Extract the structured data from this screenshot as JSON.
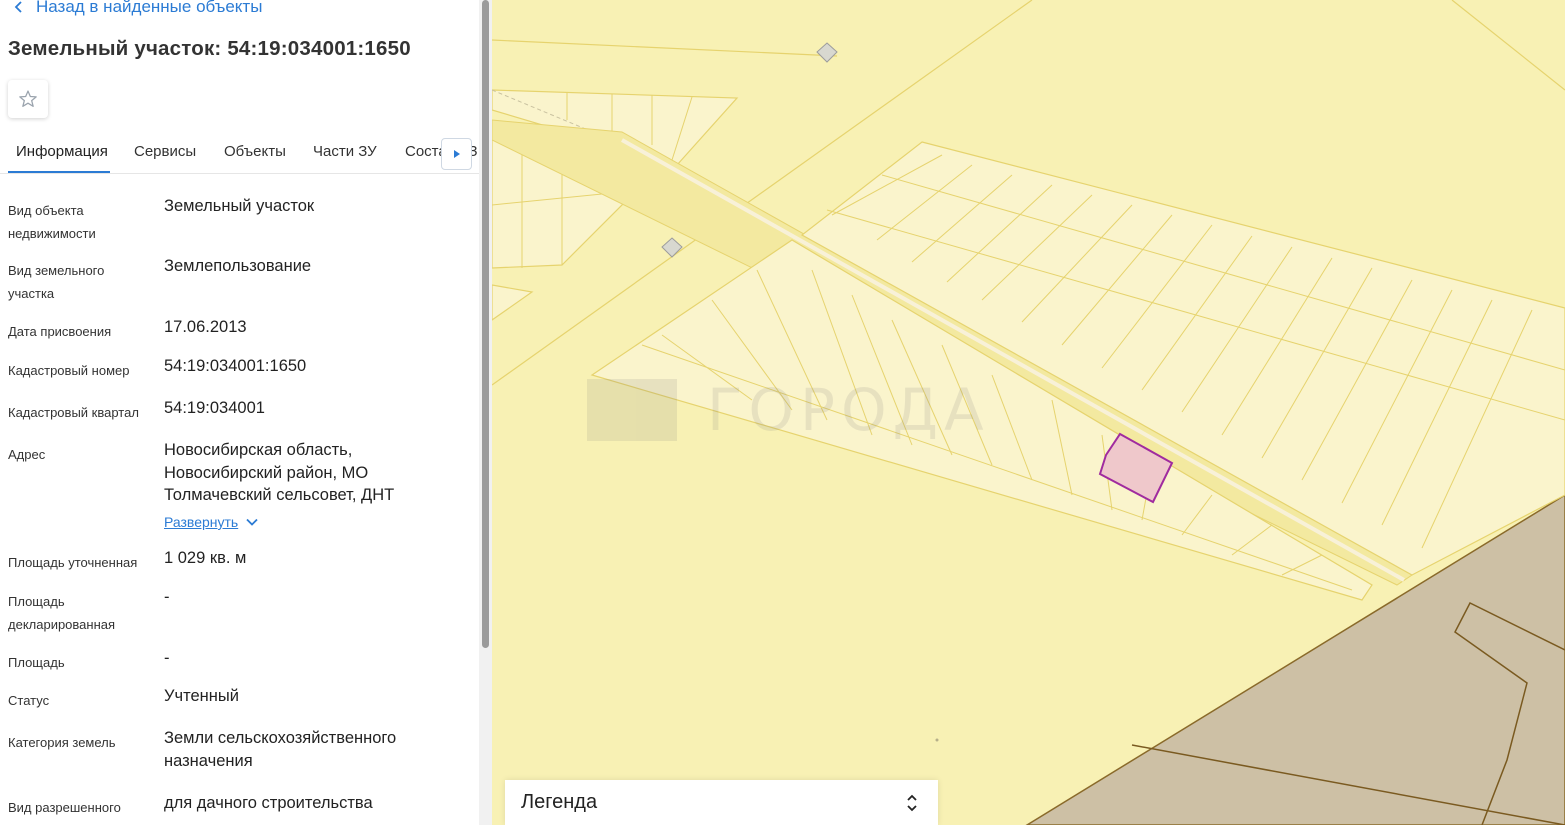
{
  "back_link": {
    "label": "Назад в найденные объекты"
  },
  "title": "Земельный участок: 54:19:034001:1650",
  "tabs": [
    {
      "label": "Информация",
      "active": true
    },
    {
      "label": "Сервисы"
    },
    {
      "label": "Объекты"
    },
    {
      "label": "Части ЗУ"
    },
    {
      "label": "Состав ЕЗП"
    }
  ],
  "info": [
    {
      "label": "Вид объекта недвижимости",
      "value": "Земельный участок"
    },
    {
      "label": "Вид земельного участка",
      "value": "Землепользование"
    },
    {
      "label": "Дата присвоения",
      "value": "17.06.2013"
    },
    {
      "label": "Кадастровый номер",
      "value": "54:19:034001:1650"
    },
    {
      "label": "Кадастровый квартал",
      "value": "54:19:034001"
    },
    {
      "label": "Адрес",
      "value": "Новосибирская область, Новосибирский район, МО Толмачевский сельсовет, ДНТ",
      "expand_label": "Развернуть"
    },
    {
      "label": "Площадь уточненная",
      "value": "1 029 кв. м"
    },
    {
      "label": "Площадь декларированная",
      "value": "-"
    },
    {
      "label": "Площадь",
      "value": "-"
    },
    {
      "label": "Статус",
      "value": "Учтенный"
    },
    {
      "label": "Категория земель",
      "value": "Земли сельскохозяйственного назначения"
    },
    {
      "label": "Вид разрешенного",
      "value": "для дачного строительства"
    }
  ],
  "map": {
    "watermark": "ГОРОДА",
    "colors": {
      "base": "#f8f1b4",
      "parcel": "#faf4cc",
      "selected_fill": "#efc8cb",
      "selected_stroke": "#a02b9f",
      "other_zone": "#cdc0a5"
    }
  },
  "legend": {
    "label": "Легенда"
  },
  "icons": {
    "back": "chevron-left-icon",
    "favorite": "star-icon",
    "tabs_next": "triangle-right-icon",
    "legend_toggle": "chevrons-up-down-icon"
  },
  "colors": {
    "accent": "#2b7bd4"
  }
}
